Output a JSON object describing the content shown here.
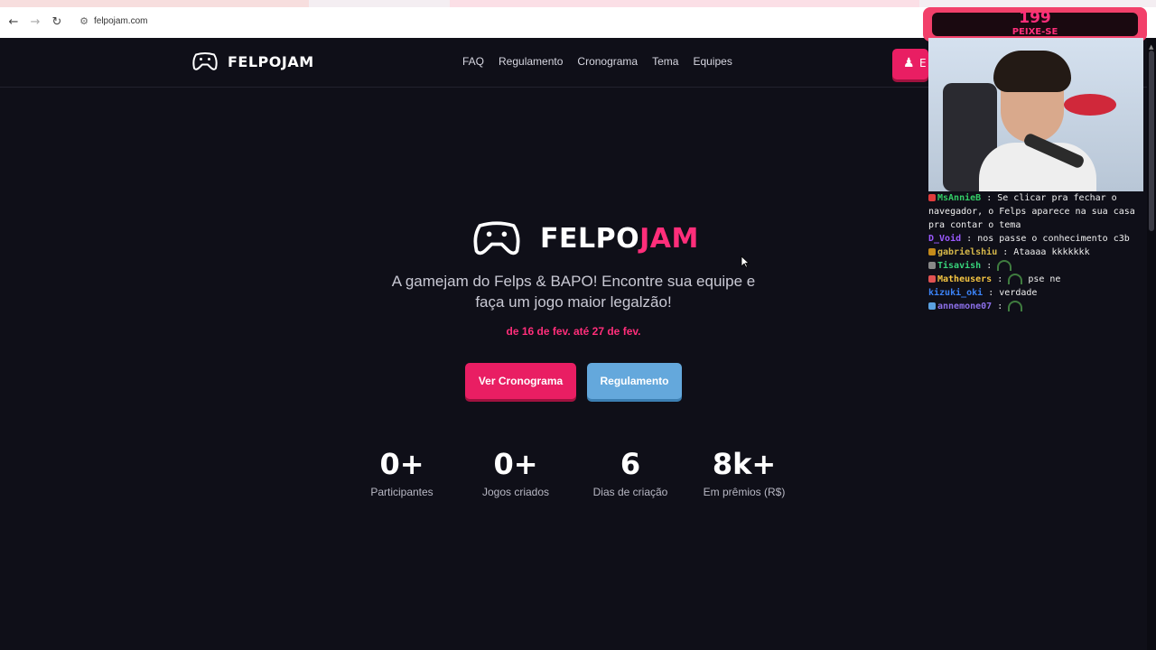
{
  "browser": {
    "back_icon": "arrow-left-icon",
    "forward_icon": "arrow-right-icon",
    "reload_icon": "reload-icon",
    "site_info_icon": "site-settings-icon",
    "url": "felpojam.com"
  },
  "header": {
    "brand": "FELPOJAM",
    "menu": [
      "FAQ",
      "Regulamento",
      "Cronograma",
      "Tema",
      "Equipes"
    ],
    "enter_label": "E"
  },
  "hero": {
    "brand_part1": "FELPO",
    "brand_part2": "JAM",
    "tagline_line1": "A gamejam do Felps & BAPO! Encontre sua equipe e",
    "tagline_line2": "faça um jogo maior legalzão!",
    "dates": "de 16 de fev. até 27 de fev.",
    "primary_button": "Ver Cronograma",
    "secondary_button": "Regulamento"
  },
  "stats": [
    {
      "value": "0+",
      "label": "Participantes"
    },
    {
      "value": "0+",
      "label": "Jogos criados"
    },
    {
      "value": "6",
      "label": "Dias de criação"
    },
    {
      "value": "8k+",
      "label": "Em prêmios (R$)"
    }
  ],
  "overlay": {
    "count": "199",
    "count_label": "PEIXE-SE"
  },
  "chat": [
    {
      "user": "MsAnnieB",
      "user_color": "#33cc66",
      "badge_color": "#e03c3c",
      "message": "Se clicar pra fechar o navegador, o Felps aparece na sua casa pra contar o tema"
    },
    {
      "user": "D_Void",
      "user_color": "#9b59ff",
      "badge_color": "",
      "message": "nos passe o conhecimento c3b"
    },
    {
      "user": "gabrielshiu",
      "user_color": "#d6b84a",
      "badge_color": "#c48a1a",
      "message": "Ataaaa kkkkkkk"
    },
    {
      "user": "Tisavish",
      "user_color": "#37d27a",
      "badge_color": "#888888",
      "message": ""
    },
    {
      "user": "Matheusers",
      "user_color": "#f5c542",
      "badge_color": "#e05252",
      "message": "pse ne"
    },
    {
      "user": "kizuki_oki",
      "user_color": "#3b82f6",
      "badge_color": "",
      "message": "verdade"
    },
    {
      "user": "annemone07",
      "user_color": "#8b6fe8",
      "badge_color": "#5aa0e0",
      "message": ""
    }
  ],
  "colors": {
    "accent_pink": "#e91e63",
    "accent_blue": "#64a8dc",
    "background": "#0f0f18"
  }
}
